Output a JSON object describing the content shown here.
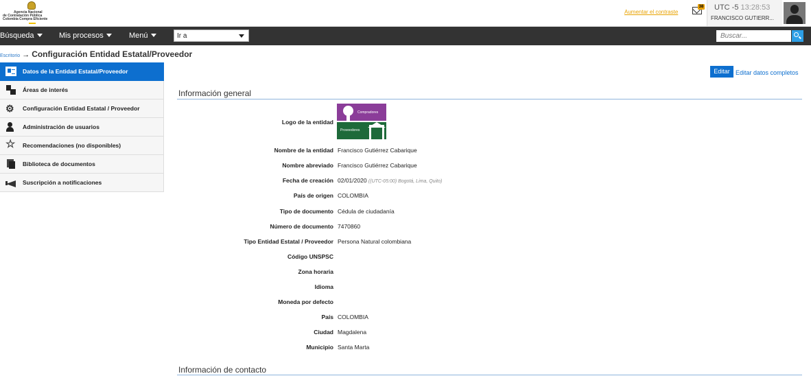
{
  "header": {
    "logo_line1": "Agencia Nacional",
    "logo_line2": "de Contratación Pública",
    "logo_line3": "Colombia Compra Eficiente",
    "contrast_link": "Aumentar el contraste",
    "mail_badge": "38",
    "utc_label": "UTC -5",
    "clock": "13:28:53",
    "user_name": "FRANCISCO GUTIERR..."
  },
  "nav": {
    "busqueda": "Búsqueda",
    "mis_procesos": "Mis procesos",
    "menu": "Menú",
    "ira": "Ir a",
    "search_placeholder": "Buscar..."
  },
  "breadcrumb": {
    "home": "Escritorio",
    "arrow": "→",
    "title": "Configuración Entidad Estatal/Proveedor"
  },
  "sidebar": {
    "items": [
      {
        "label": "Datos de la Entidad Estatal/Proveedor",
        "icon": "id-card-icon"
      },
      {
        "label": "Áreas de interés",
        "icon": "areas-icon"
      },
      {
        "label": "Configuración Entidad Estatal / Proveedor",
        "icon": "gears-icon"
      },
      {
        "label": "Administración de usuarios",
        "icon": "add-user-icon"
      },
      {
        "label": "Recomendaciones (no disponibles)",
        "icon": "star-icon"
      },
      {
        "label": "Biblioteca de documentos",
        "icon": "documents-icon"
      },
      {
        "label": "Suscripción a notificaciones",
        "icon": "megaphone-icon"
      }
    ]
  },
  "actions": {
    "edit": "Editar",
    "edit_full": "Editar datos completos"
  },
  "general": {
    "title": "Información general",
    "logo_label": "Logo de la entidad",
    "logo_top_text": "Compradores",
    "logo_bottom_text": "Proveedores",
    "rows": [
      {
        "label": "Nombre de la entidad",
        "value": "Francisco Gutiérrez Cabarique"
      },
      {
        "label": "Nombre abreviado",
        "value": "Francisco Gutiérrez Cabarique"
      },
      {
        "label": "Fecha de creación",
        "value": "02/01/2020",
        "extra": "((UTC-05:00) Bogotá, Lima, Quito)"
      },
      {
        "label": "País de origen",
        "value": "COLOMBIA"
      },
      {
        "label": "Tipo de documento",
        "value": "Cédula de ciudadanía"
      },
      {
        "label": "Número de documento",
        "value": "7470860"
      },
      {
        "label": "Tipo Entidad Estatal / Proveedor",
        "value": "Persona Natural colombiana"
      },
      {
        "label": "Código UNSPSC",
        "value": ""
      },
      {
        "label": "Zona horaria",
        "value": ""
      },
      {
        "label": "Idioma",
        "value": ""
      },
      {
        "label": "Moneda por defecto",
        "value": ""
      },
      {
        "label": "País",
        "value": "COLOMBIA"
      },
      {
        "label": "Ciudad",
        "value": "Magdalena"
      },
      {
        "label": "Municipio",
        "value": "Santa Marta"
      }
    ]
  },
  "contact": {
    "title": "Información de contacto"
  }
}
